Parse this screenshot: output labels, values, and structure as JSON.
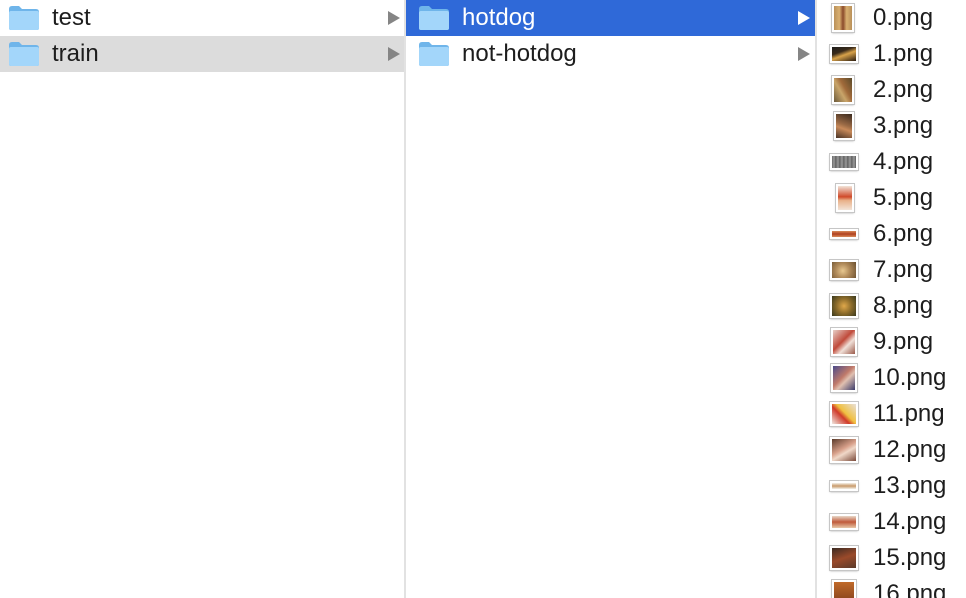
{
  "column1": {
    "items": [
      {
        "label": "test"
      },
      {
        "label": "train"
      }
    ]
  },
  "column2": {
    "items": [
      {
        "label": "hotdog"
      },
      {
        "label": "not-hotdog"
      }
    ]
  },
  "column3": {
    "files": [
      {
        "label": "0.png"
      },
      {
        "label": "1.png"
      },
      {
        "label": "2.png"
      },
      {
        "label": "3.png"
      },
      {
        "label": "4.png"
      },
      {
        "label": "5.png"
      },
      {
        "label": "6.png"
      },
      {
        "label": "7.png"
      },
      {
        "label": "8.png"
      },
      {
        "label": "9.png"
      },
      {
        "label": "10.png"
      },
      {
        "label": "11.png"
      },
      {
        "label": "12.png"
      },
      {
        "label": "13.png"
      },
      {
        "label": "14.png"
      },
      {
        "label": "15.png"
      },
      {
        "label": "16.png"
      }
    ]
  },
  "colors": {
    "selection": "#2f69d8",
    "path_highlight": "#dcdcdc",
    "folder_blue": "#8cc8f4"
  }
}
